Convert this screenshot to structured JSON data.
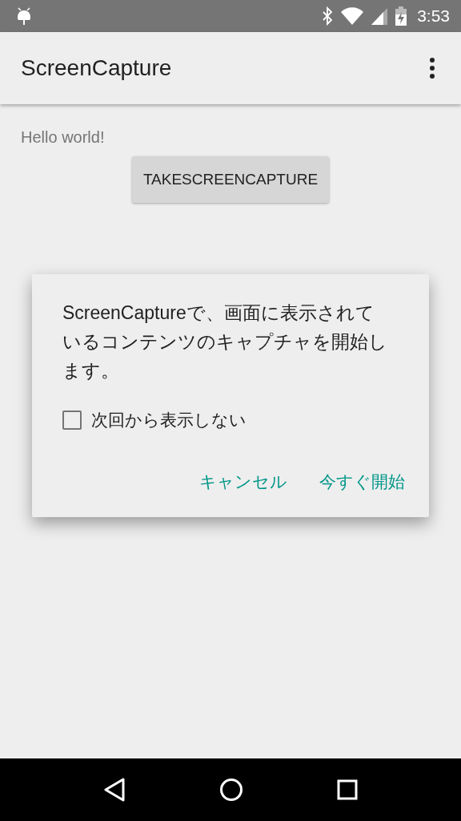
{
  "status_bar": {
    "time": "3:53"
  },
  "app_bar": {
    "title": "ScreenCapture"
  },
  "content": {
    "greeting": "Hello world!",
    "button": "TAKESCREENCAPTURE"
  },
  "dialog": {
    "message": "ScreenCaptureで、画面に表示されているコンテンツのキャプチャを開始します。",
    "checkbox": {
      "label": "次回から表示しない",
      "checked": false
    },
    "buttons": [
      "キャンセル",
      "今すぐ開始"
    ]
  }
}
